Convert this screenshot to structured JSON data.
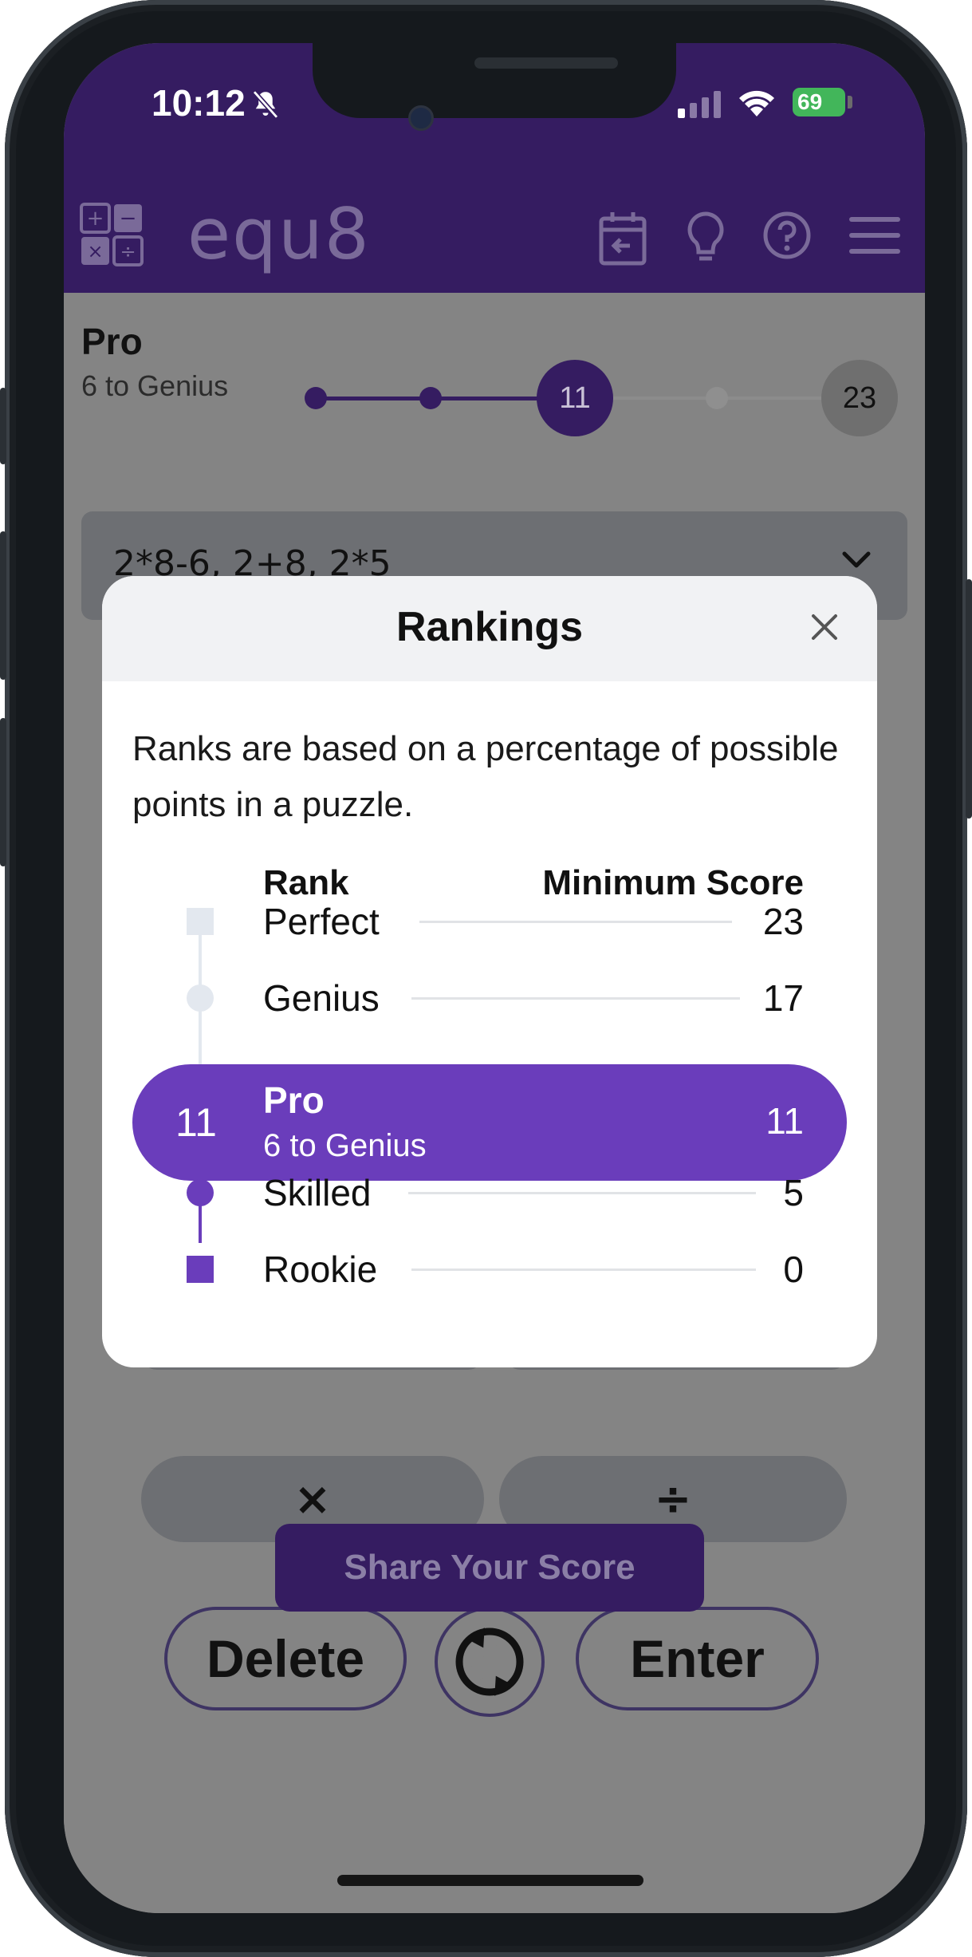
{
  "status_bar": {
    "time": "10:12",
    "battery": "69"
  },
  "app": {
    "brand": "equ8"
  },
  "header_icons": [
    "calendar-back-icon",
    "lightbulb-icon",
    "help-icon",
    "menu-icon"
  ],
  "progress": {
    "rank": "Pro",
    "subtitle": "6 to Genius",
    "current_score": "11",
    "max_score": "23"
  },
  "found_words": {
    "text": "2*8-6, 2+8, 2*5"
  },
  "operators": {
    "multiply": "×",
    "divide": "÷"
  },
  "actions": {
    "delete": "Delete",
    "enter": "Enter",
    "share": "Share Your Score"
  },
  "modal": {
    "title": "Rankings",
    "description": "Ranks are based on a percentage of possible points in a puzzle.",
    "col_rank": "Rank",
    "col_min": "Minimum Score",
    "rows": [
      {
        "rank": "Perfect",
        "min": "23"
      },
      {
        "rank": "Genius",
        "min": "17"
      },
      {
        "rank": "Pro",
        "min": "11",
        "current": true,
        "subtitle": "6 to Genius",
        "score": "11"
      },
      {
        "rank": "Skilled",
        "min": "5"
      },
      {
        "rank": "Rookie",
        "min": "0"
      }
    ]
  },
  "colors": {
    "brand_purple": "#351c61",
    "accent_purple": "#6a3dbb"
  }
}
